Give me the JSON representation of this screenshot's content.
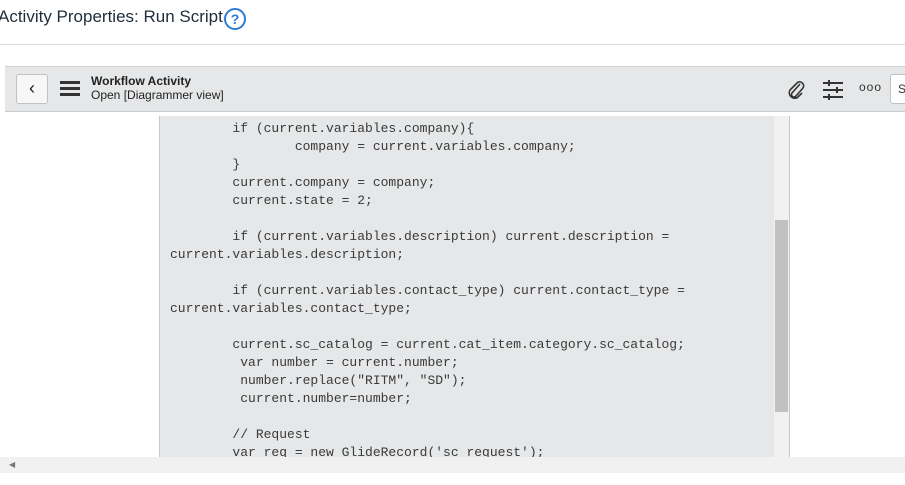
{
  "page": {
    "title": "Activity Properties: Run Script",
    "help_icon": "question-circle-icon"
  },
  "header": {
    "record_type": "Workflow Activity",
    "record_state": "Open [Diagrammer view]",
    "submit_label": "S",
    "icons": [
      "back-icon",
      "menu-icon",
      "paperclip-icon",
      "settings-sliders-icon",
      "more-icon"
    ]
  },
  "code": {
    "lines": [
      "        if (current.variables.company){",
      "                company = current.variables.company;",
      "        }",
      "        current.company = company;",
      "        current.state = 2;",
      "",
      "        if (current.variables.description) current.description =",
      "current.variables.description;",
      "",
      "        if (current.variables.contact_type) current.contact_type =",
      "current.variables.contact_type;",
      "",
      "        current.sc_catalog = current.cat_item.category.sc_catalog;",
      "         var number = current.number;",
      "         number.replace(\"RITM\", \"SD\");",
      "         current.number=number;",
      "",
      "        // Request",
      "        var req = new GlideRecord('sc request');"
    ]
  }
}
